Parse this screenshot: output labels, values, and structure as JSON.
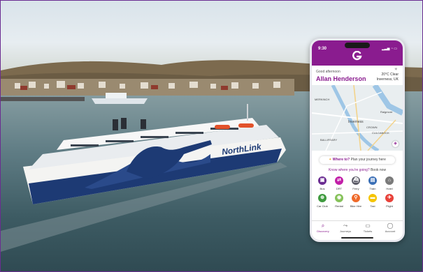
{
  "colors": {
    "brand_purple": "#8a1c8f",
    "ship_navy": "#1d3a74"
  },
  "ship": {
    "brand_text": "NorthLink"
  },
  "phone": {
    "status": {
      "time": "9:30"
    },
    "greeting": "Good afternoon",
    "user_name": "Allan Henderson",
    "weather": {
      "temp_condition": "20°C Clear",
      "location": "Inverness, UK"
    },
    "map_labels": {
      "inverness": "Inverness",
      "merkinch": "MERKINCH",
      "raigmore": "Raigmore",
      "balloch": "BALLIFEARY",
      "culcabock": "CULCABOCK",
      "crown": "CROWN"
    },
    "where_to": {
      "prompt": "Where to?",
      "action": "Plan your journey here"
    },
    "know_where": {
      "text": "Know where you're going?",
      "action": "Book now"
    },
    "services": [
      {
        "label": "Bus",
        "icon": "bus-icon",
        "color": "#6a2c91"
      },
      {
        "label": "DRT",
        "icon": "drt-icon",
        "color": "#c21fa8"
      },
      {
        "label": "Ferry",
        "icon": "ferry-icon",
        "color": "#5a5a66"
      },
      {
        "label": "Train",
        "icon": "train-icon",
        "color": "#3b6fb6"
      },
      {
        "label": "Hotel",
        "icon": "hotel-icon",
        "color": "#7a7a7a"
      },
      {
        "label": "Car Club",
        "icon": "car-club-icon",
        "color": "#3f9a3f"
      },
      {
        "label": "Rental",
        "icon": "rental-icon",
        "color": "#86c25a"
      },
      {
        "label": "Bike Hire",
        "icon": "bike-icon",
        "color": "#ef6a2a"
      },
      {
        "label": "Taxi",
        "icon": "taxi-icon",
        "color": "#f5c400"
      },
      {
        "label": "Flight",
        "icon": "flight-icon",
        "color": "#e8423a"
      }
    ],
    "tabs": [
      {
        "label": "Discovery",
        "icon": "search-icon"
      },
      {
        "label": "Journeys",
        "icon": "route-icon"
      },
      {
        "label": "Tickets",
        "icon": "ticket-icon"
      },
      {
        "label": "Account",
        "icon": "account-icon"
      }
    ]
  }
}
